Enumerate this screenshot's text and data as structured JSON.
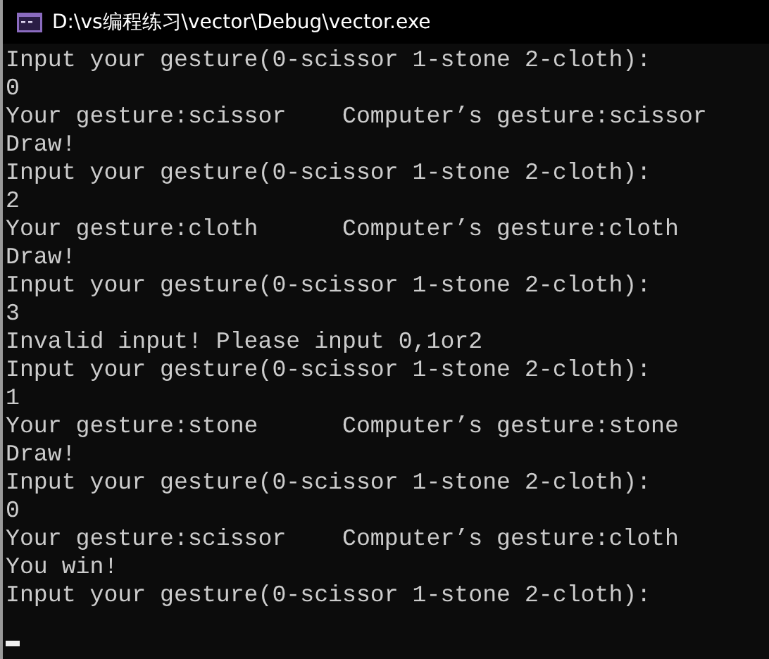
{
  "window": {
    "title": "D:\\vs编程练习\\vector\\Debug\\vector.exe"
  },
  "console": {
    "lines": [
      "Input your gesture(0-scissor 1-stone 2-cloth):",
      "0",
      "Your gesture:scissor    Computer’s gesture:scissor",
      "Draw!",
      "Input your gesture(0-scissor 1-stone 2-cloth):",
      "2",
      "Your gesture:cloth      Computer’s gesture:cloth",
      "Draw!",
      "Input your gesture(0-scissor 1-stone 2-cloth):",
      "3",
      "Invalid input! Please input 0,1or2",
      "Input your gesture(0-scissor 1-stone 2-cloth):",
      "1",
      "Your gesture:stone      Computer’s gesture:stone",
      "Draw!",
      "Input your gesture(0-scissor 1-stone 2-cloth):",
      "0",
      "Your gesture:scissor    Computer’s gesture:cloth",
      "You win!",
      "Input your gesture(0-scissor 1-stone 2-cloth):"
    ]
  }
}
